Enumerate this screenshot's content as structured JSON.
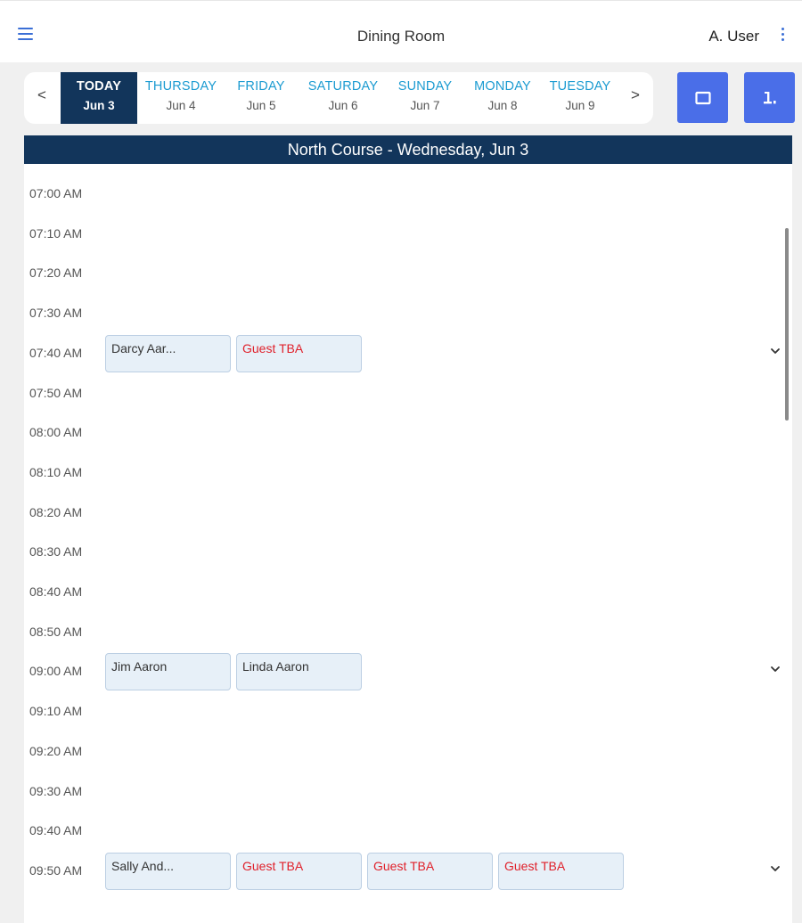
{
  "header": {
    "menu_icon": "hamburger-menu-icon",
    "title": "Dining Room",
    "user": "A. User",
    "more_icon": "kebab-menu-icon",
    "accent_color": "#3b6fd6"
  },
  "date_nav": {
    "prev": "<",
    "next": ">",
    "days": [
      {
        "name": "TODAY",
        "date": "Jun 3",
        "active": true
      },
      {
        "name": "THURSDAY",
        "date": "Jun 4"
      },
      {
        "name": "FRIDAY",
        "date": "Jun 5"
      },
      {
        "name": "SATURDAY",
        "date": "Jun 6"
      },
      {
        "name": "SUNDAY",
        "date": "Jun 7"
      },
      {
        "name": "MONDAY",
        "date": "Jun 8"
      },
      {
        "name": "TUESDAY",
        "date": "Jun 9"
      }
    ],
    "active_color": "#12355b",
    "day_link_color": "#1b9bd1"
  },
  "view_buttons": {
    "single_icon": "single-view-icon",
    "split_icon": "split-view-icon",
    "button_color": "#4a6ee8"
  },
  "course": {
    "header": "North Course - Wednesday, Jun 3"
  },
  "schedule": {
    "expand_icon": "chevron-down-icon",
    "guest_color": "#e0202a",
    "slots": [
      {
        "time": "07:00 AM",
        "players": []
      },
      {
        "time": "07:10 AM",
        "players": []
      },
      {
        "time": "07:20 AM",
        "players": []
      },
      {
        "time": "07:30 AM",
        "players": []
      },
      {
        "time": "07:40 AM",
        "players": [
          {
            "name": "Darcy Aar...",
            "guest": false
          },
          {
            "name": "Guest TBA",
            "guest": true
          }
        ]
      },
      {
        "time": "07:50 AM",
        "players": []
      },
      {
        "time": "08:00 AM",
        "players": []
      },
      {
        "time": "08:10 AM",
        "players": []
      },
      {
        "time": "08:20 AM",
        "players": []
      },
      {
        "time": "08:30 AM",
        "players": []
      },
      {
        "time": "08:40 AM",
        "players": []
      },
      {
        "time": "08:50 AM",
        "players": []
      },
      {
        "time": "09:00 AM",
        "players": [
          {
            "name": "Jim Aaron",
            "guest": false
          },
          {
            "name": "Linda Aaron",
            "guest": false
          }
        ]
      },
      {
        "time": "09:10 AM",
        "players": []
      },
      {
        "time": "09:20 AM",
        "players": []
      },
      {
        "time": "09:30 AM",
        "players": []
      },
      {
        "time": "09:40 AM",
        "players": []
      },
      {
        "time": "09:50 AM",
        "players": [
          {
            "name": "Sally And...",
            "guest": false
          },
          {
            "name": "Guest TBA",
            "guest": true
          },
          {
            "name": "Guest TBA",
            "guest": true
          },
          {
            "name": "Guest TBA",
            "guest": true
          }
        ]
      }
    ]
  }
}
